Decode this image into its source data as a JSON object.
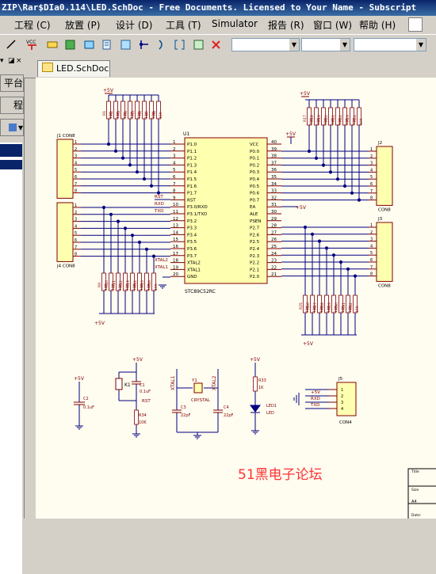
{
  "window": {
    "title": "ZIP\\Rar$DIa0.114\\LED.SchDoc - Free Documents. Licensed to Your Name - Subscript"
  },
  "menu": [
    {
      "label": "工程",
      "key": "(C)"
    },
    {
      "label": "放置",
      "key": "(P)"
    },
    {
      "label": "设计",
      "key": "(D)"
    },
    {
      "label": "工具",
      "key": "(T)"
    },
    {
      "label": "Simulator",
      "key": ""
    },
    {
      "label": "报告",
      "key": "(R)"
    },
    {
      "label": "窗口",
      "key": "(W)"
    },
    {
      "label": "帮助",
      "key": "(H)"
    }
  ],
  "toolbar": {
    "vcc_label": "VCC",
    "icons": [
      "net-icon",
      "vcc-icon",
      "port-icon",
      "bus-icon",
      "component-icon",
      "sheet-icon",
      "wire-icon",
      "junction-icon",
      "harness-icon",
      "bracket-icon",
      "delete-icon"
    ]
  },
  "left_panel": {
    "tab1": "平台",
    "tab2": "程"
  },
  "document_tab": {
    "label": "LED.SchDoc"
  },
  "schematic": {
    "u1": {
      "ref": "U1",
      "part": "STC89C52RC",
      "left_pins": [
        {
          "num": "1",
          "name": "P1.0"
        },
        {
          "num": "2",
          "name": "P1.1"
        },
        {
          "num": "3",
          "name": "P1.2"
        },
        {
          "num": "4",
          "name": "P1.3"
        },
        {
          "num": "5",
          "name": "P1.4"
        },
        {
          "num": "6",
          "name": "P1.5"
        },
        {
          "num": "7",
          "name": "P1.6"
        },
        {
          "num": "8",
          "name": "P1.7"
        },
        {
          "num": "9",
          "name": "RST"
        },
        {
          "num": "10",
          "name": "P3.0/RXD"
        },
        {
          "num": "11",
          "name": "P3.1/TXD"
        },
        {
          "num": "12",
          "name": "P3.2"
        },
        {
          "num": "13",
          "name": "P3.3"
        },
        {
          "num": "14",
          "name": "P3.4"
        },
        {
          "num": "15",
          "name": "P3.5"
        },
        {
          "num": "16",
          "name": "P3.6"
        },
        {
          "num": "17",
          "name": "P3.7"
        },
        {
          "num": "18",
          "name": "XTAL2"
        },
        {
          "num": "19",
          "name": "XTAL1"
        },
        {
          "num": "20",
          "name": "GND"
        }
      ],
      "right_pins": [
        {
          "num": "40",
          "name": "VCC"
        },
        {
          "num": "39",
          "name": "P0.0"
        },
        {
          "num": "38",
          "name": "P0.1"
        },
        {
          "num": "37",
          "name": "P0.2"
        },
        {
          "num": "36",
          "name": "P0.3"
        },
        {
          "num": "35",
          "name": "P0.4"
        },
        {
          "num": "34",
          "name": "P0.5"
        },
        {
          "num": "33",
          "name": "P0.6"
        },
        {
          "num": "32",
          "name": "P0.7"
        },
        {
          "num": "31",
          "name": "EA"
        },
        {
          "num": "30",
          "name": "ALE"
        },
        {
          "num": "29",
          "name": "PSEN"
        },
        {
          "num": "28",
          "name": "P2.7"
        },
        {
          "num": "27",
          "name": "P2.6"
        },
        {
          "num": "26",
          "name": "P2.5"
        },
        {
          "num": "25",
          "name": "P2.4"
        },
        {
          "num": "24",
          "name": "P2.3"
        },
        {
          "num": "23",
          "name": "P2.2"
        },
        {
          "num": "22",
          "name": "P2.1"
        },
        {
          "num": "21",
          "name": "P2.0"
        }
      ]
    },
    "net_labels": {
      "rst": "RST",
      "rxd": "RXD",
      "txd": "TXD",
      "xtal2": "XTAL2",
      "xtal1": "XTAL1"
    },
    "connectors": {
      "j1": "J1 CON8",
      "j2": "J2",
      "j2_type": "CON8",
      "j3": "J3",
      "j3_type": "CON8",
      "j4": "J4 CON8",
      "j5": "J5",
      "j5_type": "CON4"
    },
    "j5_nets": [
      "+5V",
      "RXD",
      "TXD"
    ],
    "pin_numbers_8": [
      "1",
      "2",
      "3",
      "4",
      "5",
      "6",
      "7",
      "8"
    ],
    "pin_numbers_4": [
      "1",
      "2",
      "3",
      "4"
    ],
    "power": {
      "p5v": "+5V"
    },
    "res_top_left": [
      "R1",
      "R2",
      "R3",
      "R4",
      "R5",
      "R6",
      "R7",
      "R8"
    ],
    "res_top_right": [
      "R17",
      "R18",
      "R19",
      "R20",
      "R21",
      "R22",
      "R23",
      "R24"
    ],
    "res_bottom_left": [
      "R9",
      "R10",
      "R11",
      "R12",
      "R13",
      "R14",
      "R15",
      "R16"
    ],
    "res_bottom_right": [
      "R25",
      "R26",
      "R27",
      "R28",
      "R29",
      "R30",
      "R31",
      "R32"
    ],
    "res_value": "10K",
    "reset": {
      "k1": "K1",
      "c1": "C1",
      "c1_val": "0.1uF",
      "rst": "RST",
      "r34": "R34",
      "r34_val": "10K"
    },
    "power_cap": {
      "c2": "C2",
      "c2_val": "0.1uF"
    },
    "crystal": {
      "y1": "Y1",
      "y1_name": "CRYSTAL",
      "c3": "C3",
      "c3_val": "22pF",
      "c4": "C4",
      "c4_val": "22pF",
      "xtal1": "XTAL1",
      "xtal2": "XTAL2"
    },
    "led": {
      "r33": "R33",
      "r33_val": "1K",
      "led1": "LED1",
      "led1_name": "LED"
    },
    "watermark": "51黑电子论坛",
    "title_block": {
      "title": "Title",
      "size": "Size",
      "size_val": "A4",
      "date": "Date:"
    }
  },
  "colors": {
    "wire": "#000080",
    "component": "#800000",
    "body": "#ffffb0",
    "watermark": "#ff3333"
  }
}
